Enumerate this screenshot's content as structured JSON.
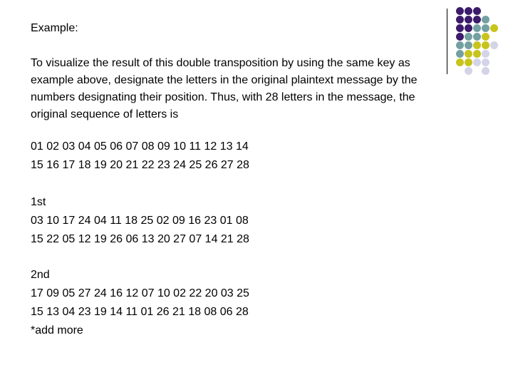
{
  "heading": "Example:",
  "intro_lines": [
    "To visualize the result of this double transposition by using the same key as",
    "example above, designate the letters in the original plaintext message by the",
    "numbers designating their position. Thus, with 28 letters in the message, the",
    "original sequence of letters is"
  ],
  "original_sequence": {
    "rows": [
      "01 02 03 04 05 06 07 08 09 10 11 12 13 14",
      "15 16 17 18 19 20 21 22 23 24 25 26 27 28"
    ]
  },
  "first_transposition": {
    "label": "1st",
    "rows": [
      "03 10 17 24 04 11 18 25 02 09 16 23 01 08",
      "15 22 05 12 19 26 06 13 20 27 07 14 21 28"
    ]
  },
  "second_transposition": {
    "label": "2nd",
    "rows": [
      "17 09 05 27 24 16 12 07 10 02 22 20 03 25",
      "15 13 04 23 19 14 11 01 26 21 18 08 06 28"
    ],
    "note": "*add more"
  },
  "decoration": {
    "colors": {
      "P": "#3b1b6b",
      "T": "#74a0a2",
      "Y": "#c8c41c",
      "L": "#d4d4e8"
    },
    "pattern": [
      "PPP..",
      "PPPT.",
      "PPTTY",
      "PTTY.",
      "TTYYL",
      "TYYL.",
      "YYLL.",
      ".L.L."
    ]
  }
}
